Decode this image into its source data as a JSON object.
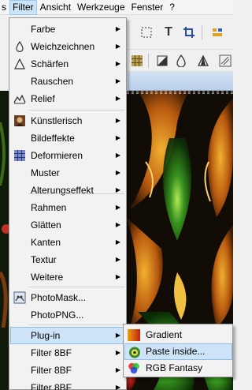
{
  "menubar": {
    "items": [
      "s",
      "Filter",
      "Ansicht",
      "Werkzeuge",
      "Fenster",
      "?"
    ],
    "active_index": 1
  },
  "filter_menu": {
    "items": [
      {
        "label": "Farbe",
        "icon": "none",
        "submenu": true
      },
      {
        "label": "Weichzeichnen",
        "icon": "drop-icon",
        "submenu": true
      },
      {
        "label": "Schärfen",
        "icon": "triangle-icon",
        "submenu": true
      },
      {
        "label": "Rauschen",
        "icon": "none",
        "submenu": true
      },
      {
        "label": "Relief",
        "icon": "relief-icon",
        "submenu": true
      },
      {
        "label": "Künstlerisch",
        "icon": "portrait-icon",
        "submenu": true
      },
      {
        "label": "Bildeffekte",
        "icon": "none",
        "submenu": true
      },
      {
        "label": "Deformieren",
        "icon": "grid-icon",
        "submenu": true
      },
      {
        "label": "Muster",
        "icon": "none",
        "submenu": true
      },
      {
        "label": "Alterungseffekt",
        "icon": "none",
        "submenu": true
      },
      {
        "label": "Rahmen",
        "icon": "none",
        "submenu": true
      },
      {
        "label": "Glätten",
        "icon": "none",
        "submenu": true
      },
      {
        "label": "Kanten",
        "icon": "none",
        "submenu": true
      },
      {
        "label": "Textur",
        "icon": "none",
        "submenu": true
      },
      {
        "label": "Weitere",
        "icon": "none",
        "submenu": true
      },
      {
        "label": "PhotoMask...",
        "icon": "photomask-icon",
        "submenu": false
      },
      {
        "label": "PhotoPNG...",
        "icon": "none",
        "submenu": false
      },
      {
        "label": "Plug-in",
        "icon": "none",
        "submenu": true
      },
      {
        "label": "Filter 8BF",
        "icon": "none",
        "submenu": true
      },
      {
        "label": "Filter 8BF",
        "icon": "none",
        "submenu": true
      },
      {
        "label": "Filter 8BF",
        "icon": "none",
        "submenu": true
      }
    ],
    "highlighted_index": 17
  },
  "plugin_submenu": {
    "items": [
      {
        "label": "Gradient",
        "icon": "gradient-icon"
      },
      {
        "label": "Paste inside...",
        "icon": "paste-inside-icon"
      },
      {
        "label": "RGB Fantasy",
        "icon": "rgb-fantasy-icon"
      }
    ],
    "highlighted_index": 1
  },
  "toolbar": {
    "row1_icons": [
      "selection-dashed-icon",
      "text-tool-icon",
      "crop-tool-icon",
      "tools-icon"
    ],
    "row2_icons": [
      "grid-icon",
      "exposure-icon",
      "drop-icon",
      "sharpen-icon",
      "pattern-icon"
    ]
  },
  "colors": {
    "menu_bg": "#f2f2f2",
    "highlight_bg": "#cde3f7",
    "highlight_border": "#8fbde6",
    "doc_title_bg": "#c6d9f0"
  }
}
